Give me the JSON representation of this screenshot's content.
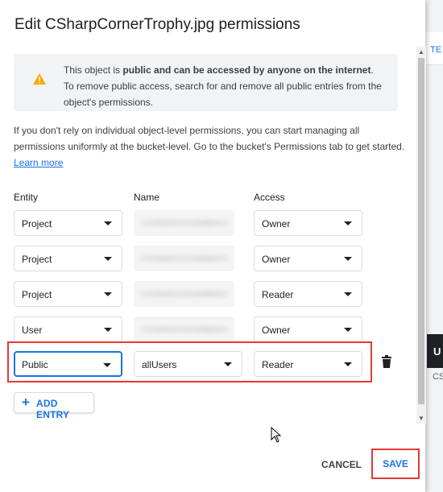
{
  "background": {
    "tab_hint": "TE",
    "dark_label": "U",
    "cs_label": "CS"
  },
  "dialog": {
    "title": "Edit CSharpCornerTrophy.jpg permissions",
    "warning": {
      "icon": "warning-icon",
      "pre": "This object is ",
      "bold": "public and can be accessed by anyone on the internet",
      "post": ". To remove public access, search for and remove all public entries from the object's permissions."
    },
    "info": {
      "text": "If you don't rely on individual object-level permissions, you can start managing all permissions uniformly at the bucket-level. Go to the bucket's Permissions tab to get started. ",
      "link": "Learn more"
    },
    "columns": {
      "entity": "Entity",
      "name": "Name",
      "access": "Access"
    },
    "rows": [
      {
        "entity": "Project",
        "access": "Owner"
      },
      {
        "entity": "Project",
        "access": "Owner"
      },
      {
        "entity": "Project",
        "access": "Reader"
      },
      {
        "entity": "User",
        "access": "Owner"
      },
      {
        "entity": "Public",
        "name": "allUsers",
        "access": "Reader"
      }
    ],
    "add_entry": "ADD ENTRY",
    "cancel": "CANCEL",
    "save": "SAVE"
  },
  "colors": {
    "accent": "#1a73e8",
    "highlight": "#e53935",
    "warning": "#f9ab00"
  }
}
